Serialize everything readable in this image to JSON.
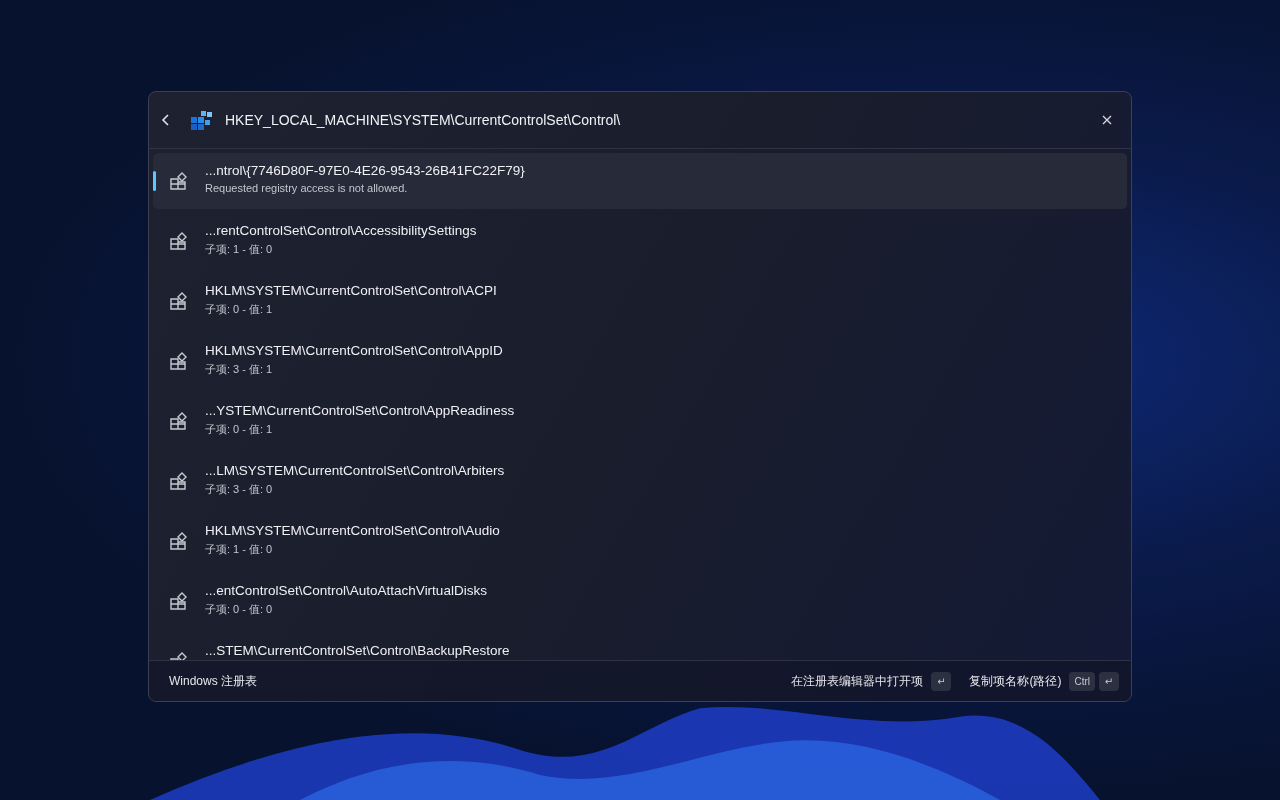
{
  "search": {
    "value": "HKEY_LOCAL_MACHINE\\SYSTEM\\CurrentControlSet\\Control\\"
  },
  "results": [
    {
      "title": "...ntrol\\{7746D80F-97E0-4E26-9543-26B41FC22F79}",
      "subtitle": "Requested registry access is not allowed.",
      "selected": true
    },
    {
      "title": "...rentControlSet\\Control\\AccessibilitySettings",
      "subtitle": "子项: 1 - 值: 0",
      "selected": false
    },
    {
      "title": "HKLM\\SYSTEM\\CurrentControlSet\\Control\\ACPI",
      "subtitle": "子项: 0 - 值: 1",
      "selected": false
    },
    {
      "title": "HKLM\\SYSTEM\\CurrentControlSet\\Control\\AppID",
      "subtitle": "子项: 3 - 值: 1",
      "selected": false
    },
    {
      "title": "...YSTEM\\CurrentControlSet\\Control\\AppReadiness",
      "subtitle": "子项: 0 - 值: 1",
      "selected": false
    },
    {
      "title": "...LM\\SYSTEM\\CurrentControlSet\\Control\\Arbiters",
      "subtitle": "子项: 3 - 值: 0",
      "selected": false
    },
    {
      "title": "HKLM\\SYSTEM\\CurrentControlSet\\Control\\Audio",
      "subtitle": "子项: 1 - 值: 0",
      "selected": false
    },
    {
      "title": "...entControlSet\\Control\\AutoAttachVirtualDisks",
      "subtitle": "子项: 0 - 值: 0",
      "selected": false
    },
    {
      "title": "...STEM\\CurrentControlSet\\Control\\BackupRestore",
      "selected": false
    }
  ],
  "footer": {
    "source": "Windows 注册表",
    "actions": [
      {
        "label": "在注册表编辑器中打开项",
        "keys": [
          "↵"
        ]
      },
      {
        "label": "复制项名称(路径)",
        "keys": [
          "Ctrl",
          "↵"
        ]
      }
    ]
  }
}
